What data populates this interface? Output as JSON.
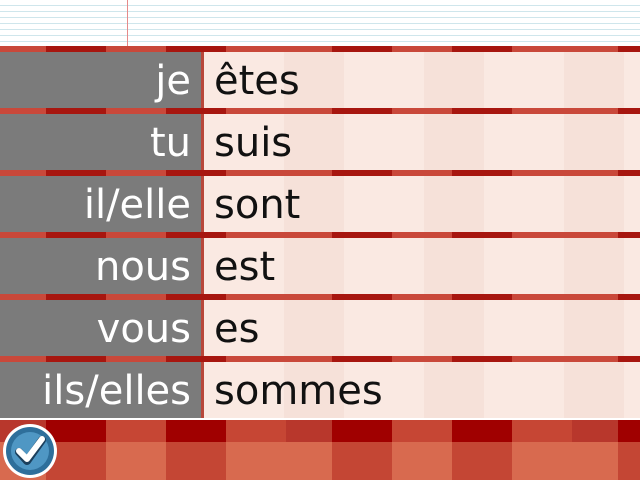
{
  "rows": [
    {
      "pronoun": "je",
      "form": "êtes"
    },
    {
      "pronoun": "tu",
      "form": "suis"
    },
    {
      "pronoun": "il/elle",
      "form": "sont"
    },
    {
      "pronoun": "nous",
      "form": "est"
    },
    {
      "pronoun": "vous",
      "form": "es"
    },
    {
      "pronoun": "ils/elles",
      "form": "sommes"
    }
  ],
  "check_button": {
    "icon": "checkmark-icon"
  },
  "colors": {
    "pronoun_bg": "#7b7b7b",
    "form_bg": "#fae9e2",
    "accent_red": "#a00000",
    "check_blue": "#2e6f9b"
  }
}
